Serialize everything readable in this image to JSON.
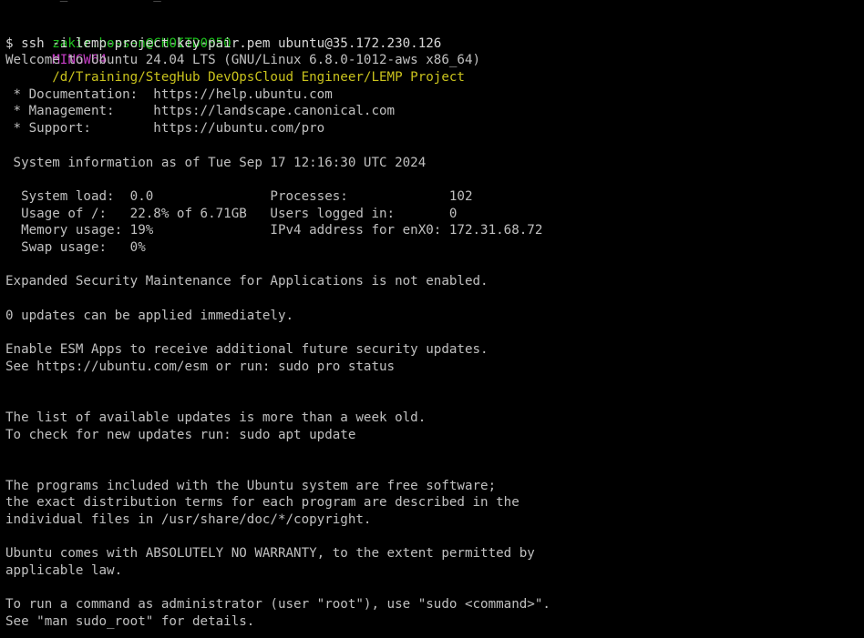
{
  "colors": {
    "background": "#000000",
    "text": "#c0c0c0",
    "prompt_user": "#1fc21f",
    "prompt_shell": "#c73ec7",
    "prompt_path": "#c9c21d"
  },
  "prompt": {
    "user_host": "zakir.hossen@CHOITD0050",
    "shell": "MINGW64",
    "path": "/d/Training/StegHub DevOpsCloud Engineer/LEMP Project"
  },
  "command": "$ ssh -i lemp-project-key-pair.pem ubuntu@35.172.230.126",
  "output": [
    "Welcome to Ubuntu 24.04 LTS (GNU/Linux 6.8.0-1012-aws x86_64)",
    "",
    " * Documentation:  https://help.ubuntu.com",
    " * Management:     https://landscape.canonical.com",
    " * Support:        https://ubuntu.com/pro",
    "",
    " System information as of Tue Sep 17 12:16:30 UTC 2024",
    "",
    "  System load:  0.0               Processes:             102",
    "  Usage of /:   22.8% of 6.71GB   Users logged in:       0",
    "  Memory usage: 19%               IPv4 address for enX0: 172.31.68.72",
    "  Swap usage:   0%",
    "",
    "Expanded Security Maintenance for Applications is not enabled.",
    "",
    "0 updates can be applied immediately.",
    "",
    "Enable ESM Apps to receive additional future security updates.",
    "See https://ubuntu.com/esm or run: sudo pro status",
    "",
    "",
    "The list of available updates is more than a week old.",
    "To check for new updates run: sudo apt update",
    "",
    "",
    "The programs included with the Ubuntu system are free software;",
    "the exact distribution terms for each program are described in the",
    "individual files in /usr/share/doc/*/copyright.",
    "",
    "Ubuntu comes with ABSOLUTELY NO WARRANTY, to the extent permitted by",
    "applicable law.",
    "",
    "To run a command as administrator (user \"root\"), use \"sudo <command>\".",
    "See \"man sudo_root\" for details."
  ]
}
